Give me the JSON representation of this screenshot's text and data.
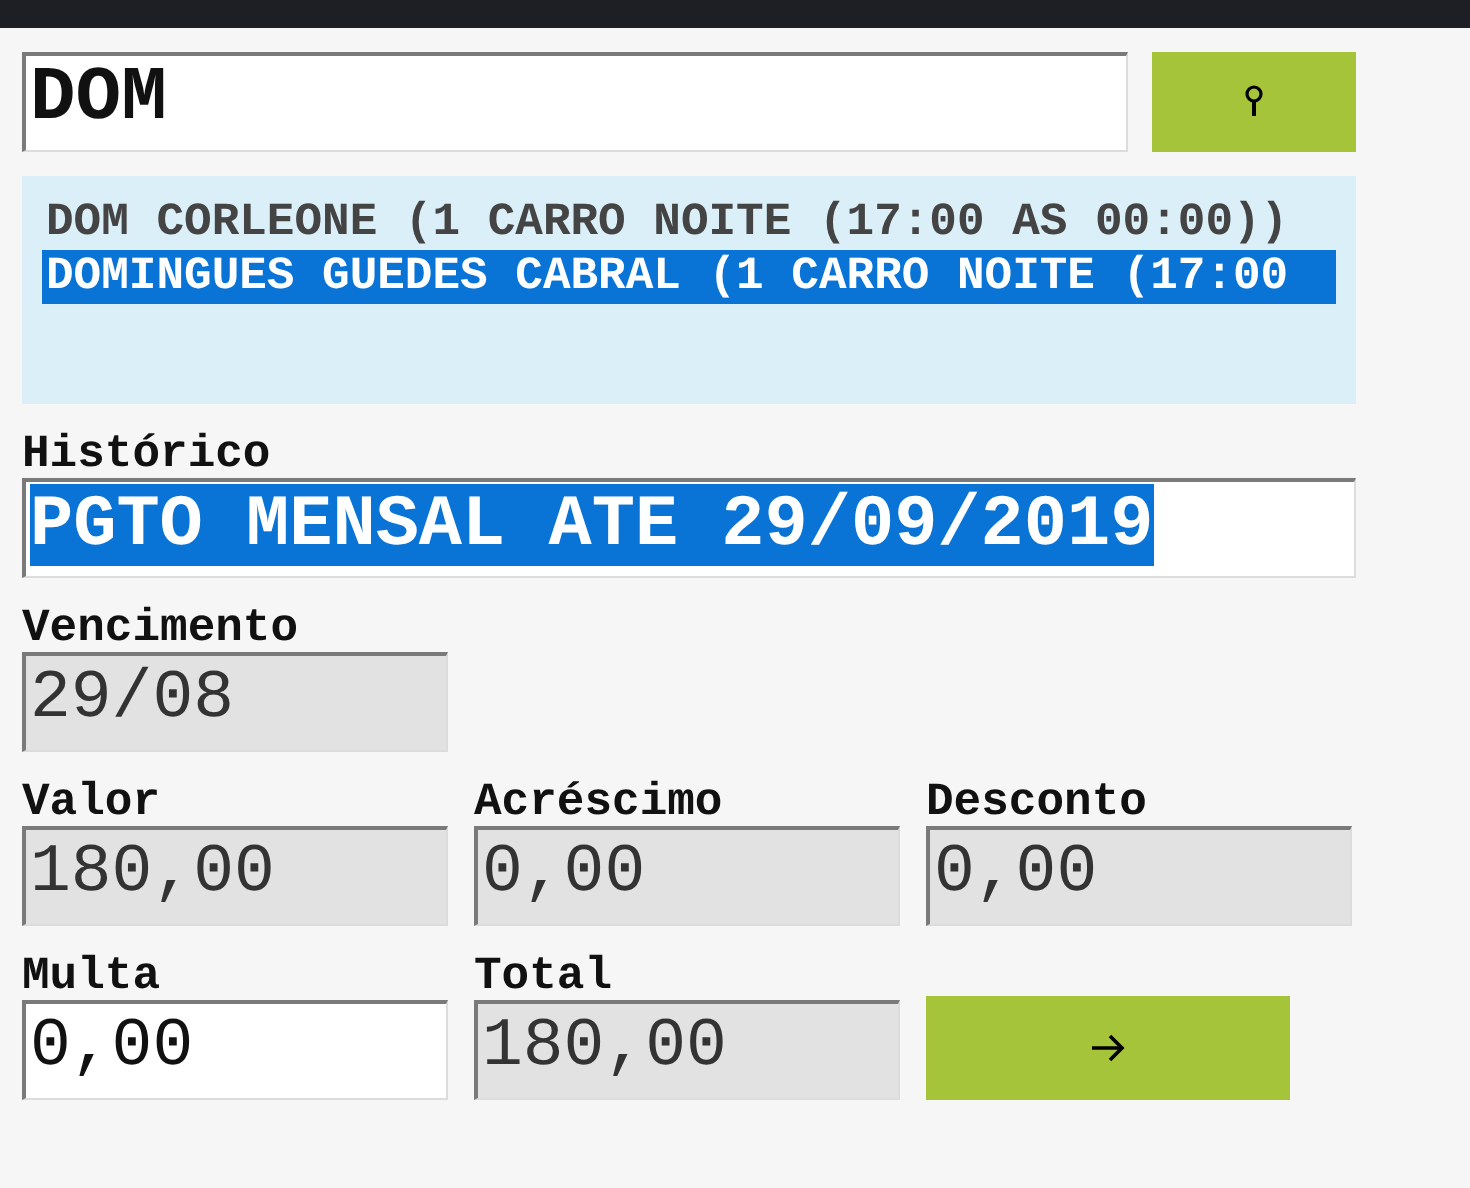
{
  "search": {
    "value": "DOM"
  },
  "results": [
    {
      "label": "DOM CORLEONE (1 CARRO NOITE (17:00 AS 00:00))",
      "selected": false
    },
    {
      "label": "DOMINGUES GUEDES CABRAL (1 CARRO NOITE (17:00",
      "selected": true
    }
  ],
  "historico": {
    "label": "Histórico",
    "value": "PGTO MENSAL ATE 29/09/2019",
    "text_selected": true,
    "readonly": false
  },
  "fields": [
    {
      "label": "Vencimento",
      "value": "29/08",
      "readonly": true
    },
    {
      "label": "Valor",
      "value": "180,00",
      "readonly": true
    },
    {
      "label": "Acréscimo",
      "value": "0,00",
      "readonly": true
    },
    {
      "label": "Desconto",
      "value": "0,00",
      "readonly": true
    },
    {
      "label": "Multa",
      "value": "0,00",
      "readonly": false
    },
    {
      "label": "Total",
      "value": "180,00",
      "readonly": true
    }
  ]
}
